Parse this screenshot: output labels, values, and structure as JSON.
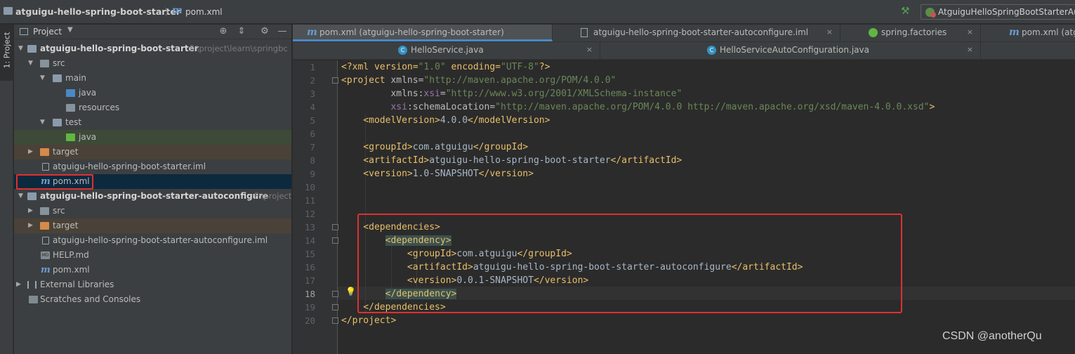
{
  "breadcrumb": {
    "project": "atguigu-hello-spring-boot-starter",
    "separator": "〉",
    "file_icon": "m",
    "file": "pom.xml"
  },
  "toolbar": {
    "run_config": "AtguiguHelloSpringBootStarterAu"
  },
  "toolstrip": {
    "project_tab": "1: Project"
  },
  "project_panel": {
    "title": "Project",
    "tree": [
      {
        "label": "atguigu-hello-spring-boot-starter",
        "path": "F:\\project\\learn\\springbc",
        "icon": "module-folder-icon",
        "bold": true
      },
      {
        "label": "src",
        "icon": "folder-icon"
      },
      {
        "label": "main",
        "icon": "folder-icon"
      },
      {
        "label": "java",
        "icon": "source-root-icon"
      },
      {
        "label": "resources",
        "icon": "resources-folder-icon"
      },
      {
        "label": "test",
        "icon": "folder-icon"
      },
      {
        "label": "java",
        "icon": "test-root-icon"
      },
      {
        "label": "target",
        "icon": "excluded-folder-icon"
      },
      {
        "label": "atguigu-hello-spring-boot-starter.iml",
        "icon": "iml-file-icon"
      },
      {
        "label": "pom.xml",
        "icon": "maven-icon",
        "maven_glyph": "m"
      },
      {
        "label": "atguigu-hello-spring-boot-starter-autoconfigure",
        "path": "F:\\project",
        "icon": "module-folder-icon",
        "bold": true
      },
      {
        "label": "src",
        "icon": "folder-icon"
      },
      {
        "label": "target",
        "icon": "excluded-folder-icon"
      },
      {
        "label": "atguigu-hello-spring-boot-starter-autoconfigure.iml",
        "icon": "iml-file-icon"
      },
      {
        "label": "HELP.md",
        "icon": "markdown-icon",
        "md_glyph": "MD"
      },
      {
        "label": "pom.xml",
        "icon": "maven-icon",
        "maven_glyph": "m"
      },
      {
        "label": "External Libraries",
        "icon": "library-icon"
      },
      {
        "label": "Scratches and Consoles",
        "icon": "scratch-icon"
      }
    ]
  },
  "tabs_row1": [
    {
      "label": "pom.xml (atguigu-hello-spring-boot-starter)",
      "icon": "m",
      "active": true
    },
    {
      "label": "atguigu-hello-spring-boot-starter-autoconfigure.iml",
      "icon": ""
    },
    {
      "label": "spring.factories",
      "icon": ""
    },
    {
      "label": "pom.xml (atg",
      "icon": "m"
    }
  ],
  "tabs_row2": [
    {
      "label": "HelloService.java",
      "icon": "C"
    },
    {
      "label": "HelloServiceAutoConfiguration.java",
      "icon": "C"
    }
  ],
  "tab_close": "×",
  "editor": {
    "line_numbers": [
      "1",
      "2",
      "3",
      "4",
      "5",
      "6",
      "7",
      "8",
      "9",
      "10",
      "11",
      "12",
      "13",
      "14",
      "15",
      "16",
      "17",
      "18",
      "19",
      "20"
    ],
    "current_line": "18",
    "bulb": "💡"
  },
  "code": {
    "l1": {
      "a": "<?xml version=",
      "b": "\"1.0\"",
      "c": " encoding=",
      "d": "\"UTF-8\"",
      "e": "?>"
    },
    "l2": {
      "a": "<project ",
      "b": "xmlns",
      "c": "=",
      "d": "\"http://maven.apache.org/POM/4.0.0\""
    },
    "l3": {
      "a": "         xmlns:",
      "b": "xsi",
      "c": "=",
      "d": "\"http://www.w3.org/2001/XMLSchema-instance\""
    },
    "l4": {
      "a": "         ",
      "b": "xsi",
      "c": ":schemaLocation=",
      "d": "\"http://maven.apache.org/POM/4.0.0 http://maven.apache.org/xsd/maven-4.0.0.xsd\"",
      "e": ">"
    },
    "l5": {
      "a": "    <modelVersion>",
      "b": "4.0.0",
      "c": "</modelVersion>"
    },
    "l7": {
      "a": "    <groupId>",
      "b": "com.atguigu",
      "c": "</groupId>"
    },
    "l8": {
      "a": "    <artifactId>",
      "b": "atguigu-hello-spring-boot-starter",
      "c": "</artifactId>"
    },
    "l9": {
      "a": "    <version>",
      "b": "1.0-SNAPSHOT",
      "c": "</version>"
    },
    "l13": {
      "a": "    <dependencies>"
    },
    "l14": {
      "a": "        ",
      "b": "<dependency>"
    },
    "l15": {
      "a": "            <groupId>",
      "b": "com.atguigu",
      "c": "</groupId>"
    },
    "l16": {
      "a": "            <artifactId>",
      "b": "atguigu-hello-spring-boot-starter-autoconfigure",
      "c": "</artifactId>"
    },
    "l17": {
      "a": "            <version>",
      "b": "0.0.1-SNAPSHOT",
      "c": "</version>"
    },
    "l18": {
      "a": "        ",
      "b": "</dependency>"
    },
    "l19": {
      "a": "    </dependencies>"
    },
    "l20": {
      "a": "</project>"
    }
  },
  "watermark": "CSDN @anotherQu",
  "colors": {
    "tag": "#e8bf6a",
    "attr_value": "#6a8759",
    "namespace": "#9876aa",
    "annotation_box": "#e03030",
    "selection": "#0d293e"
  }
}
